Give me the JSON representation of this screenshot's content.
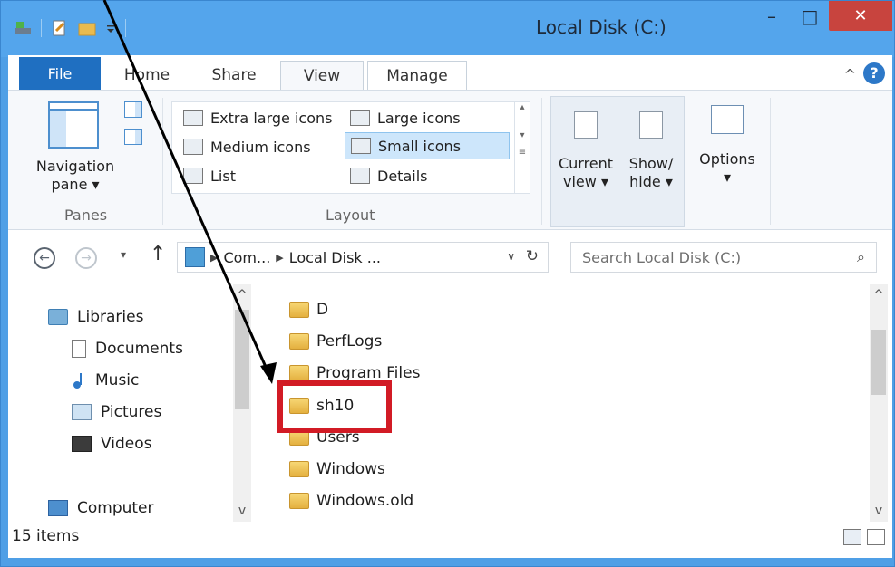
{
  "window": {
    "title": "Local Disk (C:)",
    "close_label": "✕",
    "minimize_label": "–",
    "maximize_label": "□"
  },
  "tabs": {
    "file": "File",
    "home": "Home",
    "share": "Share",
    "view": "View",
    "manage": "Manage",
    "active": "View"
  },
  "ribbon": {
    "panes": {
      "navigation_pane_line1": "Navigation",
      "navigation_pane_line2": "pane ▾",
      "group_label": "Panes"
    },
    "layout": {
      "group_label": "Layout",
      "items": [
        "Extra large icons",
        "Large icons",
        "Medium icons",
        "Small icons",
        "List",
        "Details"
      ],
      "selected": "Small icons"
    },
    "current_view": {
      "line1": "Current",
      "line2": "view ▾"
    },
    "show_hide": {
      "line1": "Show/",
      "line2": "hide ▾"
    },
    "options": {
      "label": "Options",
      "arrow": "▾"
    }
  },
  "address_bar": {
    "segments": [
      "Com...",
      "Local Disk ..."
    ],
    "search_placeholder": "Search Local Disk (C:)"
  },
  "nav_tree": {
    "items": [
      {
        "label": "Libraries",
        "icon": "libraries-icon"
      },
      {
        "label": "Documents",
        "icon": "documents-icon"
      },
      {
        "label": "Music",
        "icon": "music-icon"
      },
      {
        "label": "Pictures",
        "icon": "pictures-icon"
      },
      {
        "label": "Videos",
        "icon": "videos-icon"
      },
      {
        "label": "Computer",
        "icon": "computer-icon"
      }
    ]
  },
  "files": {
    "items": [
      "D",
      "PerfLogs",
      "Program Files",
      "sh10",
      "Users",
      "Windows",
      "Windows.old"
    ],
    "highlighted": "sh10"
  },
  "status_bar": {
    "item_count": "15 items"
  },
  "colors": {
    "title_bar": "#54a5ec",
    "file_tab": "#1f6fc1",
    "close_button": "#c8443e",
    "highlight_box": "#d21b25",
    "folder": "#e4b03f"
  }
}
